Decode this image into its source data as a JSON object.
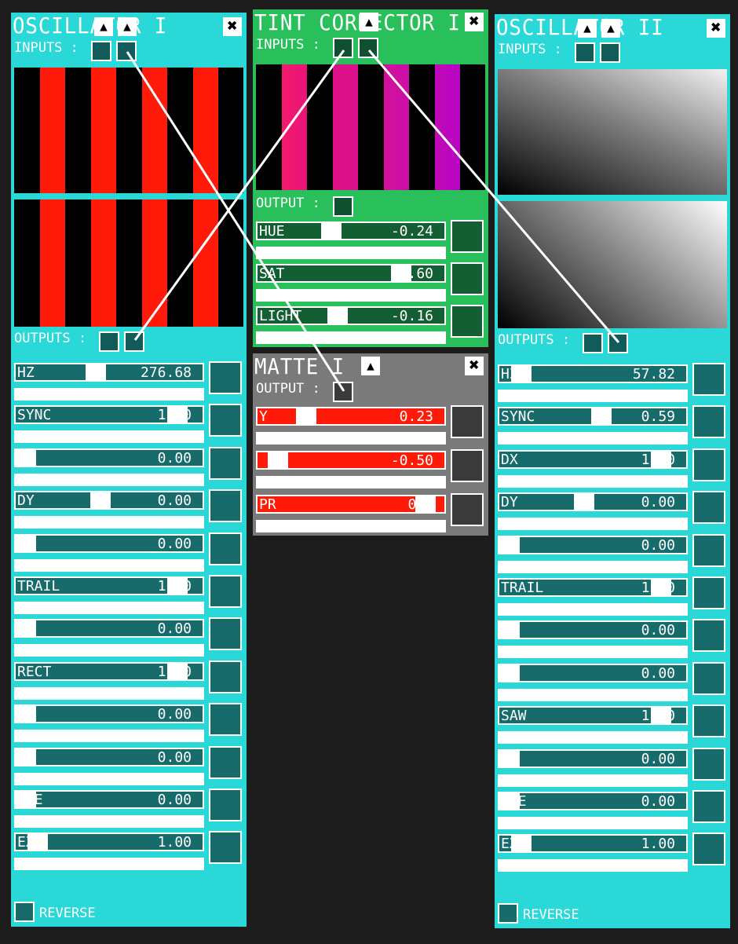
{
  "osc1": {
    "title": "OSCILLATOR I",
    "inputs_label": "INPUTS :",
    "outputs_label": "OUTPUTS :",
    "reverse_label": "REVERSE",
    "sliders": [
      {
        "name": "HZ",
        "value": "276.68",
        "fraction": 0.42
      },
      {
        "name": "SYNC",
        "value": "1.00",
        "fraction": 0.91
      },
      {
        "name": "",
        "value": "0.00",
        "fraction": 0.0
      },
      {
        "name": "DY",
        "value": "0.00",
        "fraction": 0.45
      },
      {
        "name": "D",
        "value": "0.00",
        "fraction": 0.0
      },
      {
        "name": "TRAIL",
        "value": "1.00",
        "fraction": 0.91
      },
      {
        "name": "NE",
        "value": "0.00",
        "fraction": 0.0
      },
      {
        "name": "RECT",
        "value": "1.00",
        "fraction": 0.91
      },
      {
        "name": "U",
        "value": "0.00",
        "fraction": 0.0
      },
      {
        "name": "C",
        "value": "0.00",
        "fraction": 0.0
      },
      {
        "name": "ISE",
        "value": "0.00",
        "fraction": 0.0
      },
      {
        "name": "EX",
        "value": "1.00",
        "fraction": 0.07
      }
    ]
  },
  "tint": {
    "title": "TINT CORRECTOR I",
    "inputs_label": "INPUTS :",
    "output_label": "OUTPUT :",
    "sliders": [
      {
        "name": "HUE",
        "value": "-0.24",
        "fraction": 0.38
      },
      {
        "name": "SAT",
        "value": ".60",
        "fraction": 0.8
      },
      {
        "name": "LIGHT",
        "value": "-0.16",
        "fraction": 0.42
      }
    ]
  },
  "matte": {
    "title": "MATTE I",
    "output_label": "OUTPUT :",
    "sliders": [
      {
        "name": "Y",
        "value": "0.23",
        "fraction": 0.23
      },
      {
        "name": "",
        "value": "-0.50",
        "fraction": 0.06
      },
      {
        "name": "PR",
        "value": "0.5",
        "fraction": 0.95
      }
    ]
  },
  "osc2": {
    "title": "OSCILLATOR II",
    "inputs_label": "INPUTS :",
    "outputs_label": "OUTPUTS :",
    "reverse_label": "REVERSE",
    "sliders": [
      {
        "name": "HZ",
        "value": "57.82",
        "fraction": 0.07
      },
      {
        "name": "SYNC",
        "value": "0.59",
        "fraction": 0.55
      },
      {
        "name": "DX",
        "value": "1.00",
        "fraction": 0.91
      },
      {
        "name": "DY",
        "value": "0.00",
        "fraction": 0.45
      },
      {
        "name": "D",
        "value": "0.00",
        "fraction": 0.0
      },
      {
        "name": "TRAIL",
        "value": "1.00",
        "fraction": 0.91
      },
      {
        "name": "NE",
        "value": "0.00",
        "fraction": 0.0
      },
      {
        "name": "CT",
        "value": "0.00",
        "fraction": 0.0
      },
      {
        "name": "SAW",
        "value": "1.00",
        "fraction": 0.91
      },
      {
        "name": "C",
        "value": "0.00",
        "fraction": 0.0
      },
      {
        "name": "ISE",
        "value": "0.00",
        "fraction": 0.0
      },
      {
        "name": "EX",
        "value": "1.00",
        "fraction": 0.07
      }
    ]
  },
  "icons": {
    "close": "close-icon",
    "up": "chevron-up-icon"
  },
  "colors": {
    "cyan_panel": "#2ad8d8",
    "green_panel": "#29c05c",
    "grey_panel": "#7a7a7a",
    "red": "#ff1a0a",
    "background": "#1c1c1c"
  }
}
